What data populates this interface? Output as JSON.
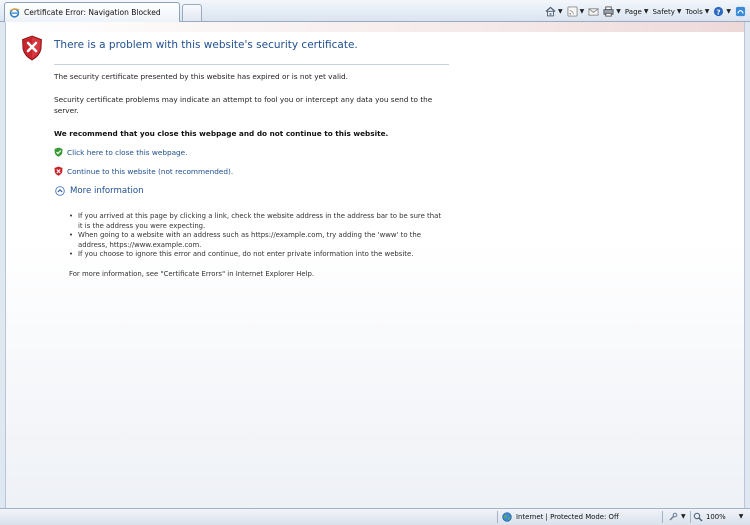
{
  "tab": {
    "title": "Certificate Error: Navigation Blocked",
    "icon": "ie-page-icon"
  },
  "command_bar": {
    "items": [
      {
        "label": "",
        "icon": "home-icon"
      },
      {
        "label": "",
        "icon": "rss-feeds-icon"
      },
      {
        "label": "",
        "icon": "mail-icon"
      },
      {
        "label": "",
        "icon": "print-icon"
      },
      {
        "label": "Page",
        "icon": ""
      },
      {
        "label": "Safety",
        "icon": ""
      },
      {
        "label": "Tools",
        "icon": ""
      },
      {
        "label": "",
        "icon": "help-icon"
      },
      {
        "label": "",
        "icon": "research-icon"
      }
    ]
  },
  "page": {
    "title": "There is a problem with this website's security certificate.",
    "para1": "The security certificate presented by this website has expired or is not yet valid.",
    "para2": "Security certificate problems may indicate an attempt to fool you or intercept any data you send to the server.",
    "recommendation": "We recommend that you close this webpage and do not continue to this website.",
    "close_link": "Click here to close this webpage.",
    "continue_link": "Continue to this website (not recommended).",
    "more_info_label": "More information",
    "bullets": [
      "If you arrived at this page by clicking a link, check the website address in the address bar to be sure that it is the address you were expecting.",
      "When going to a website with an address such as https://example.com, try adding the 'www' to the address, https://www.example.com.",
      "If you choose to ignore this error and continue, do not enter private information into the website."
    ],
    "footnote": "For more information, see \"Certificate Errors\" in Internet Explorer Help."
  },
  "status_bar": {
    "zone_text": "Internet | Protected Mode: Off",
    "zoom": "100%"
  },
  "colors": {
    "link": "#1e4e8a",
    "title": "#1f4f8f",
    "shield_red": "#c8242b",
    "shield_green": "#3a9a35"
  }
}
